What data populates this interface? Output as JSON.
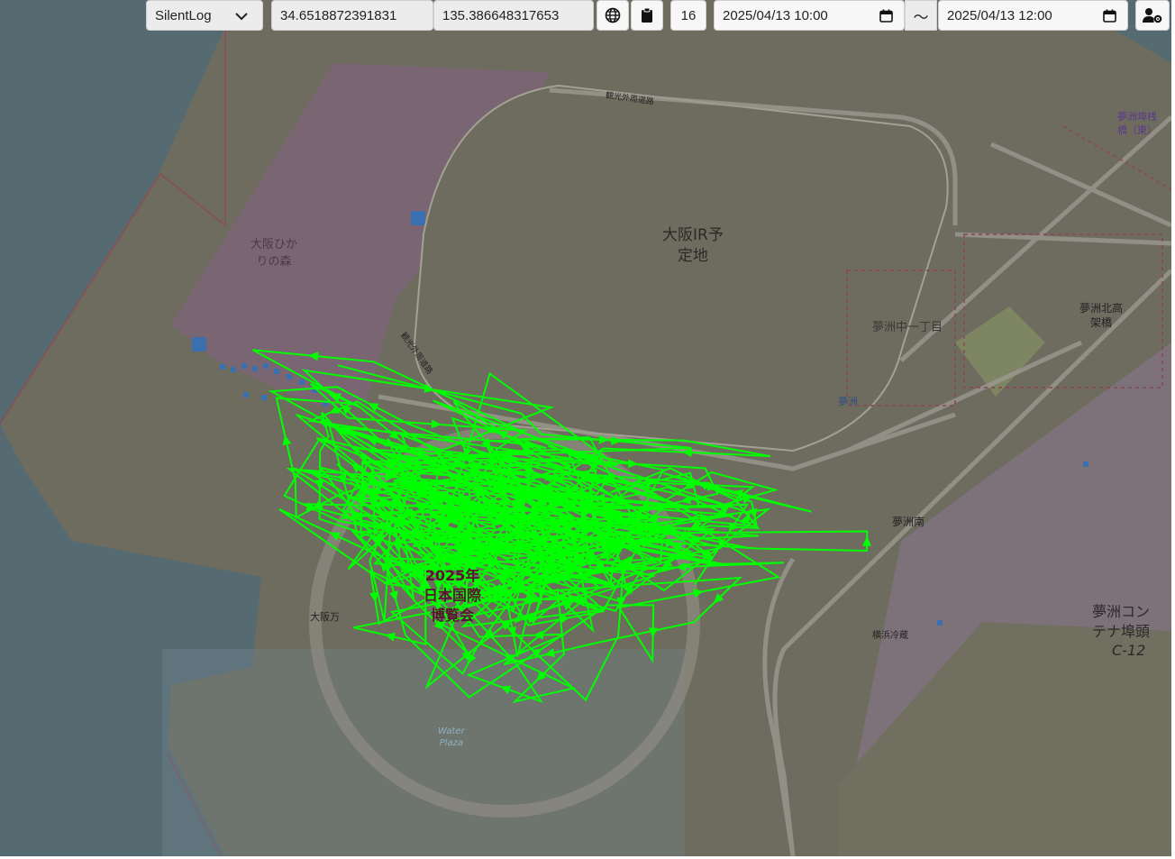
{
  "toolbar": {
    "source_select": "SilentLog",
    "latitude": "34.6518872391831",
    "longitude": "135.386648317653",
    "zoom": "16",
    "start_datetime": "2025/04/13 10:00",
    "range_separator": "〜",
    "end_datetime": "2025/04/13 12:00",
    "icons": [
      "globe-icon",
      "clipboard-icon",
      "calendar-icon",
      "user-settings-icon",
      "chevron-down-icon"
    ]
  },
  "map": {
    "labels": {
      "ir_site": "大阪IR予\n定地",
      "hikari_forest": "大阪ひか\nりの森",
      "kanko_road_top": "観光外周道路",
      "kanko_road_mid": "観光外周道路",
      "yumeshima_naka": "夢洲中一丁目",
      "yumeshima": "夢洲",
      "yumeshima_north_bridge": "夢洲北高\n架橋",
      "yumeshima_bridge_east": "夢洲埠桟\n橋（東）",
      "container_terminal": "夢洲コン\nテナ埠頭",
      "container_code": "C-12",
      "expo": "2025年\n日本国際\n博覧会",
      "water_plaza": "Water\nPlaza",
      "yumeshima_minami": "夢洲南",
      "yokohama": "横浜冷蔵",
      "osaka_expo_small": "大阪万"
    },
    "colors": {
      "water": "#566a72",
      "land": "#6e6c5f",
      "park": "#7a6572",
      "container": "#7d7279",
      "track": "#00ff00",
      "road": "#9c9a90",
      "boundary": "#8a4a55"
    },
    "track": {
      "name": "gps-track",
      "color": "#00ff00"
    }
  }
}
